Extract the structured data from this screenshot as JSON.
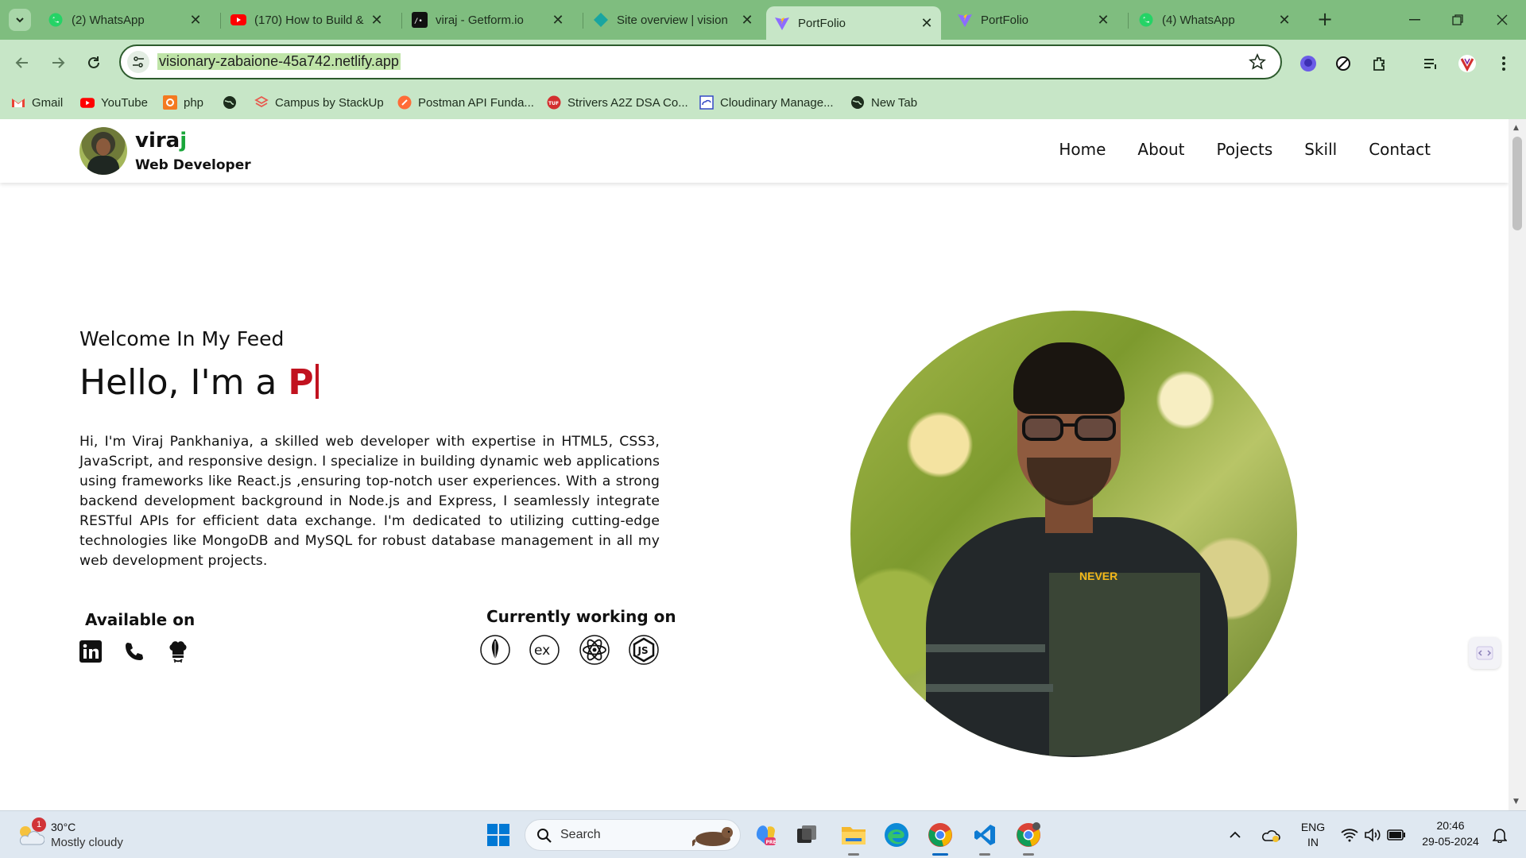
{
  "browser": {
    "tabs": [
      {
        "title": "(2) WhatsApp",
        "favicon": "whatsapp-icon",
        "active": false
      },
      {
        "title": "(170) How to Build & ",
        "favicon": "youtube-icon",
        "active": false
      },
      {
        "title": "viraj - Getform.io",
        "favicon": "getform-icon",
        "active": false
      },
      {
        "title": "Site overview | vision",
        "favicon": "netlify-icon",
        "active": false
      },
      {
        "title": "PortFolio",
        "favicon": "vite-icon",
        "active": true
      },
      {
        "title": "PortFolio",
        "favicon": "vite-icon",
        "active": false
      },
      {
        "title": "(4) WhatsApp",
        "favicon": "whatsapp-icon",
        "active": false
      }
    ],
    "url": "visionary-zabaione-45a742.netlify.app",
    "bookmarks": [
      {
        "label": "Gmail",
        "icon": "gmail-icon"
      },
      {
        "label": "YouTube",
        "icon": "youtube-icon"
      },
      {
        "label": "php",
        "icon": "php-icon"
      },
      {
        "label": "",
        "icon": "globe-icon"
      },
      {
        "label": "Campus by StackUp",
        "icon": "stackup-icon"
      },
      {
        "label": "Postman API Funda...",
        "icon": "postman-icon"
      },
      {
        "label": "Strivers A2Z DSA Co...",
        "icon": "tuf-icon"
      },
      {
        "label": "Cloudinary Manage...",
        "icon": "cloudinary-icon"
      },
      {
        "label": "New Tab",
        "icon": "globe-icon"
      }
    ],
    "accent": "#7fbd7f"
  },
  "site": {
    "brand": {
      "name_main": "vira",
      "name_accent": "j",
      "role": "Web Developer",
      "accent_color": "#1aa63a"
    },
    "nav": [
      "Home",
      "About",
      "Pojects",
      "Skill",
      "Contact"
    ],
    "hero": {
      "welcome": "Welcome In My Feed",
      "hello": "Hello, I'm a",
      "typed": "P",
      "typed_color": "#c1121f",
      "bio": "Hi, I'm Viraj Pankhaniya, a skilled web developer with expertise in HTML5, CSS3, JavaScript, and responsive design. I specialize in building dynamic web applications using frameworks like React.js ,ensuring top-notch user experiences. With a strong backend development background in Node.js and Express, I seamlessly integrate RESTful APIs for efficient data exchange. I'm dedicated to utilizing cutting-edge technologies like MongoDB and MySQL for robust database management in all my web development projects."
    },
    "available": {
      "title": "Available on",
      "icons": [
        "linkedin-icon",
        "phone-icon",
        "chef-hat-icon"
      ]
    },
    "working": {
      "title": "Currently working on",
      "icons": [
        "mongodb-icon",
        "express-icon",
        "react-icon",
        "nodejs-icon"
      ],
      "express_text": "ex",
      "node_text": "JS"
    },
    "portrait_print": "NEVER"
  },
  "taskbar": {
    "weather": {
      "badge": "1",
      "temp": "30°C",
      "condition": "Mostly cloudy"
    },
    "search_placeholder": "Search",
    "lang_top": "ENG",
    "lang_bottom": "IN",
    "time": "20:46",
    "date": "29-05-2024",
    "apps": [
      "start-icon",
      "copilot-icon",
      "task-view-icon",
      "file-explorer-icon",
      "edge-icon",
      "chrome-icon",
      "vscode-icon",
      "chrome-beta-icon"
    ]
  }
}
